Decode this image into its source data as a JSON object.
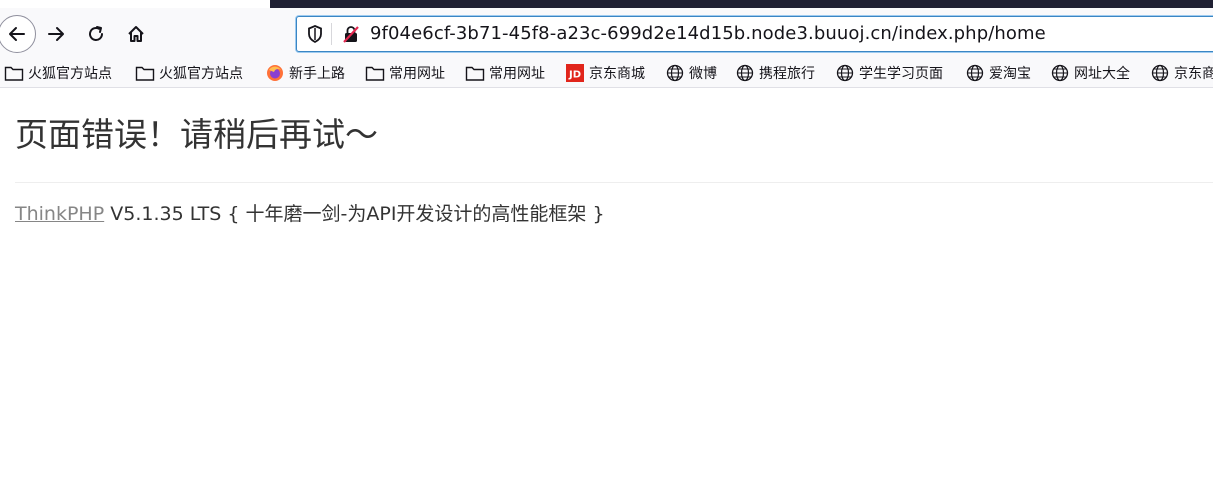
{
  "browser": {
    "url": "9f04e6cf-3b71-45f8-a23c-699d2e14d15b.node3.buuoj.cn/index.php/home",
    "icons": {
      "back": "back-arrow-icon",
      "forward": "forward-arrow-icon",
      "reload": "reload-icon",
      "home": "home-icon",
      "tracking": "shield-icon",
      "insecure": "insecure-lock-icon"
    }
  },
  "bookmarks": [
    {
      "label": "火狐官方站点",
      "icon": "folder-icon"
    },
    {
      "label": "火狐官方站点",
      "icon": "folder-icon"
    },
    {
      "label": "新手上路",
      "icon": "firefox-icon"
    },
    {
      "label": "常用网址",
      "icon": "folder-icon"
    },
    {
      "label": "常用网址",
      "icon": "folder-icon"
    },
    {
      "label": "京东商城",
      "icon": "jd-icon"
    },
    {
      "label": "微博",
      "icon": "globe-icon"
    },
    {
      "label": "携程旅行",
      "icon": "globe-icon"
    },
    {
      "label": "学生学习页面",
      "icon": "globe-icon"
    },
    {
      "label": "爱淘宝",
      "icon": "globe-icon"
    },
    {
      "label": "网址大全",
      "icon": "globe-icon"
    },
    {
      "label": "京东商",
      "icon": "globe-icon"
    }
  ],
  "page": {
    "error_title": "页面错误！请稍后再试～",
    "framework_link": "ThinkPHP",
    "version": " V5.1.35 LTS",
    "slogan": " { 十年磨一剑-为API开发设计的高性能框架 }"
  },
  "colors": {
    "accent_border": "#3a86c4",
    "link": "#868686",
    "text": "#333333",
    "jd_red": "#e1251b"
  }
}
